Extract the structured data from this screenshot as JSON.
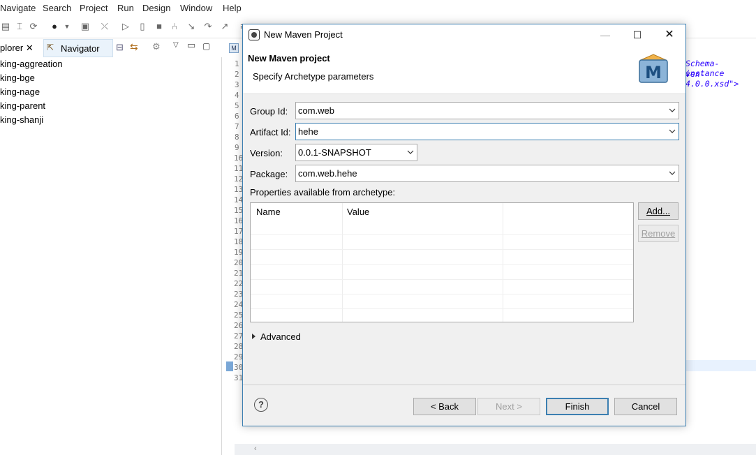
{
  "menu": [
    "Navigate",
    "Search",
    "Project",
    "Run",
    "Design",
    "Window",
    "Help"
  ],
  "left_panel": {
    "tab_explorer": "plorer ✕",
    "tab_navigator": "Navigator",
    "projects": [
      "king-aggreation",
      "king-bge",
      "king-nage",
      "king-parent",
      "king-shanji"
    ]
  },
  "editor": {
    "line_numbers_top": [
      "1",
      "2",
      "3",
      "4",
      "5",
      "6",
      "7",
      "8",
      "9"
    ],
    "line_numbers_bottom": [
      "16",
      "11",
      "12",
      "13",
      "14",
      "15",
      "16",
      "17",
      "18",
      "19",
      "20",
      "21",
      "22",
      "23",
      "24",
      "25",
      "26",
      "27",
      "28",
      "29",
      "30",
      "31"
    ],
    "code_line1": "Schema-instance",
    "code_line2": "ven-4.0.0.xsd\">"
  },
  "dialog": {
    "title": "New Maven Project",
    "banner_title": "New Maven project",
    "banner_subtitle": "Specify Archetype parameters",
    "logo_letter": "M",
    "fields": {
      "group_id_label": "Group Id:",
      "group_id_value": "com.web",
      "artifact_id_label": "Artifact Id:",
      "artifact_id_value": "hehe",
      "version_label": "Version:",
      "version_value": "0.0.1-SNAPSHOT",
      "package_label": "Package:",
      "package_value": "com.web.hehe"
    },
    "properties_label": "Properties available from archetype:",
    "table_headers": [
      "Name",
      "Value"
    ],
    "add_button": "Add...",
    "remove_button": "Remove",
    "advanced_label": "Advanced",
    "back_button": "< Back",
    "next_button": "Next >",
    "finish_button": "Finish",
    "cancel_button": "Cancel",
    "help_symbol": "?"
  },
  "colors": {
    "accent": "#3c7fb1",
    "disabled_text": "#a0a0a0",
    "code_string": "#2a00ff"
  }
}
